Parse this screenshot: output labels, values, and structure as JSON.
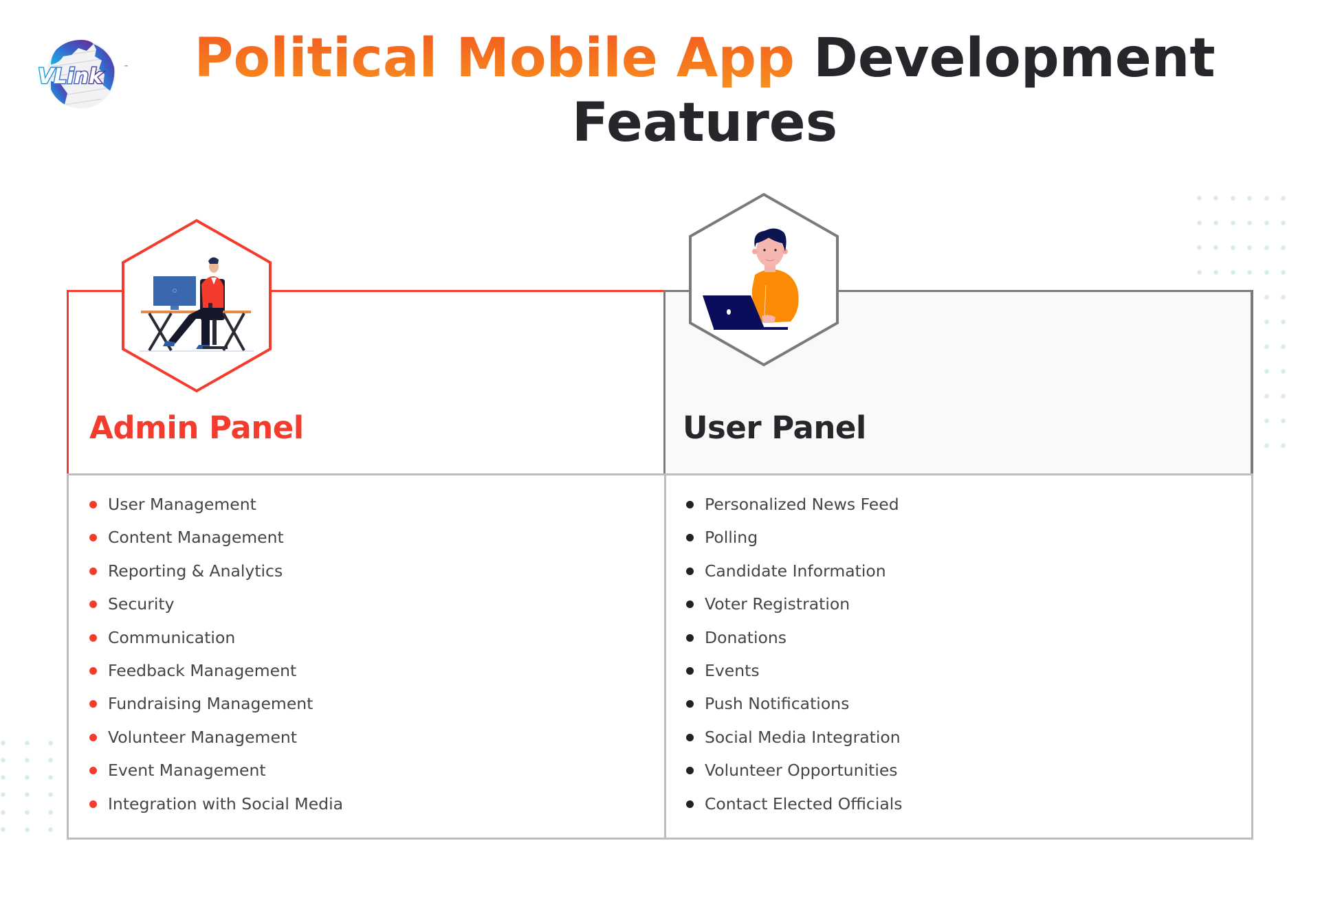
{
  "brand": {
    "logo_text": "VLink",
    "logo_trademark": "™",
    "logo_icon": "globe-icon"
  },
  "header": {
    "title_accent": "Political Mobile App",
    "title_rest_line1": "Development",
    "title_line2": "Features",
    "accent_gradient": [
      "#f2581f",
      "#f7901e"
    ],
    "title_color": "#26262b"
  },
  "panels": {
    "admin": {
      "title": "Admin Panel",
      "accent_color": "#f33c2e",
      "illustration": "admin-at-desk-illustration",
      "items": [
        {
          "label": "User Management"
        },
        {
          "label": "Content Management"
        },
        {
          "label": "Reporting & Analytics"
        },
        {
          "label": "Security"
        },
        {
          "label": "Communication"
        },
        {
          "label": "Feedback Management"
        },
        {
          "label": "Fundraising Management"
        },
        {
          "label": "Volunteer Management"
        },
        {
          "label": "Event Management"
        },
        {
          "label": "Integration with Social Media"
        }
      ]
    },
    "user": {
      "title": "User Panel",
      "accent_color": "#7a7a7a",
      "illustration": "user-with-laptop-illustration",
      "items": [
        {
          "label": "Personalized News Feed"
        },
        {
          "label": "Polling"
        },
        {
          "label": "Candidate Information"
        },
        {
          "label": "Voter Registration"
        },
        {
          "label": "Donations"
        },
        {
          "label": "Events"
        },
        {
          "label": "Push Notifications"
        },
        {
          "label": "Social Media Integration"
        },
        {
          "label": "Volunteer Opportunities"
        },
        {
          "label": "Contact Elected Officials"
        }
      ]
    }
  }
}
